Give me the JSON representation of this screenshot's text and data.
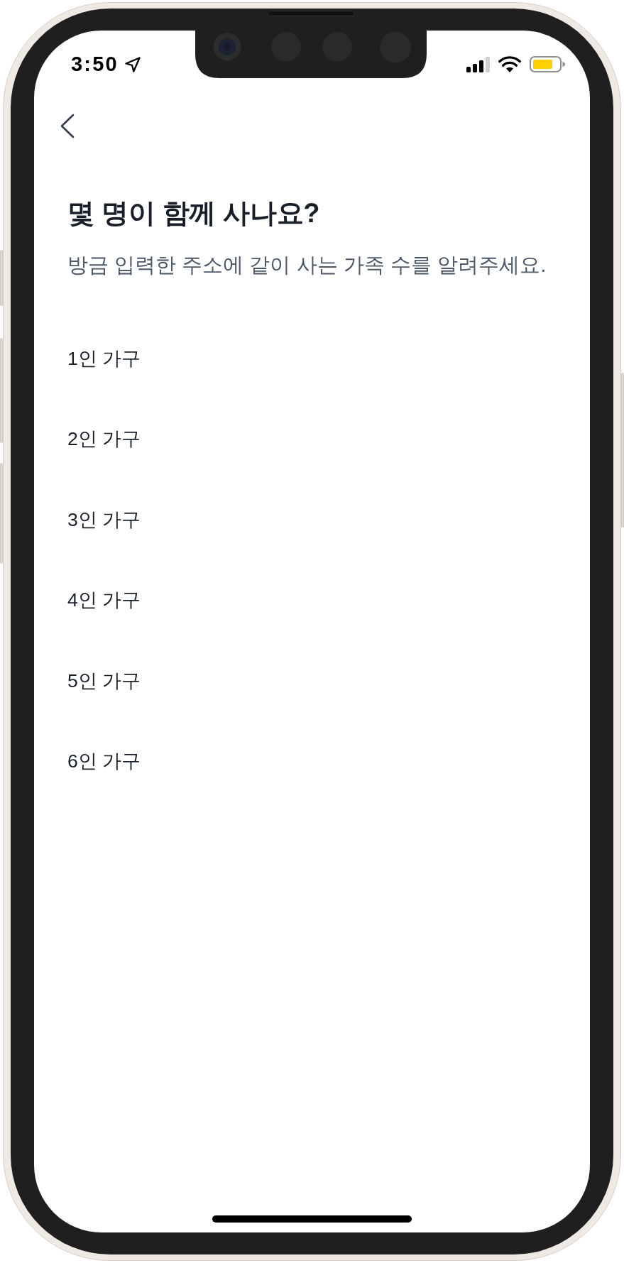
{
  "status_bar": {
    "time": "3:50"
  },
  "title": "몇 명이 함께 사나요?",
  "subtitle": "방금 입력한 주소에 같이 사는 가족 수를 알려주세요.",
  "options": [
    {
      "label": "1인 가구",
      "selected": false
    },
    {
      "label": "2인 가구",
      "selected": false
    },
    {
      "label": "3인 가구",
      "selected": false
    },
    {
      "label": "4인 가구",
      "selected": false
    },
    {
      "label": "5인 가구",
      "selected": false
    },
    {
      "label": "6인 가구",
      "selected": false
    }
  ]
}
